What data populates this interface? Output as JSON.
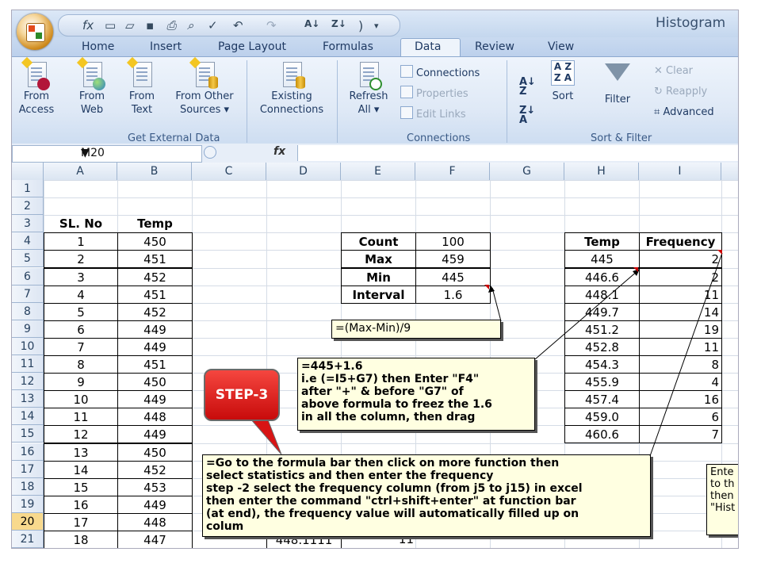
{
  "window": {
    "app_title": "Histogram"
  },
  "tabs": [
    "Home",
    "Insert",
    "Page Layout",
    "Formulas",
    "Data",
    "Review",
    "View"
  ],
  "active_tab": "Data",
  "ribbon": {
    "from_access": [
      "From",
      "Access"
    ],
    "from_web": [
      "From",
      "Web"
    ],
    "from_text": [
      "From",
      "Text"
    ],
    "from_other": [
      "From Other",
      "Sources ▾"
    ],
    "existing": [
      "Existing",
      "Connections"
    ],
    "group_external": "Get External Data",
    "refresh": [
      "Refresh",
      "All ▾"
    ],
    "connections": "Connections",
    "properties": "Properties",
    "edit_links": "Edit Links",
    "group_connections": "Connections",
    "sort": "Sort",
    "filter": "Filter",
    "clear": "Clear",
    "reapply": "Reapply",
    "advanced": "Advanced",
    "group_sort": "Sort & Filter"
  },
  "formula_bar": {
    "name_box": "M20",
    "fx": "fx"
  },
  "columns": [
    "A",
    "B",
    "C",
    "D",
    "E",
    "F",
    "G",
    "H",
    "I"
  ],
  "rows": [
    "1",
    "2",
    "3",
    "4",
    "5",
    "6",
    "7",
    "8",
    "9",
    "10",
    "11",
    "12",
    "13",
    "14",
    "15",
    "16",
    "17",
    "18",
    "19",
    "20",
    "21"
  ],
  "selected_row": "20",
  "headers": {
    "sl_no": "SL. No",
    "temp": "Temp",
    "temp2": "Temp",
    "frequency": "Frequency"
  },
  "sl_no": [
    "1",
    "2",
    "3",
    "4",
    "5",
    "6",
    "7",
    "8",
    "9",
    "10",
    "11",
    "12",
    "13",
    "14",
    "15",
    "16",
    "17",
    "18"
  ],
  "temps": [
    "450",
    "451",
    "452",
    "451",
    "452",
    "449",
    "449",
    "451",
    "450",
    "449",
    "448",
    "449",
    "450",
    "452",
    "453",
    "449",
    "448",
    "447"
  ],
  "stats": [
    {
      "label": "Count",
      "value": "100"
    },
    {
      "label": "Max",
      "value": "459"
    },
    {
      "label": "Min",
      "value": "445"
    },
    {
      "label": "Interval",
      "value": "1.6"
    }
  ],
  "bins": [
    "445",
    "446.6",
    "448.1",
    "449.7",
    "451.2",
    "452.8",
    "454.3",
    "455.9",
    "457.4",
    "459.0",
    "460.6"
  ],
  "frequencies": [
    "2",
    "2",
    "11",
    "14",
    "19",
    "11",
    "8",
    "4",
    "16",
    "6",
    "7"
  ],
  "row21": {
    "d": "448.1111",
    "e": "11"
  },
  "notes": {
    "interval_formula": "=(Max-Min)/9",
    "bin_formula": [
      "=445+1.6",
      " i.e (=I5+G7) then Enter \"F4\"",
      "after \"+\" & before \"G7\" of",
      "above formula to freez the 1.6",
      "in all the column, then drag"
    ],
    "step_label": "STEP-3",
    "frequency_instructions": [
      "=Go to the formula bar then click on more function then",
      "select statistics and then enter the frequency",
      " step -2 select the frequency column (from j5 to j15) in excel",
      "then enter the command \"ctrl+shift+enter\" at function bar",
      "(at end), the frequency value will automatically filled up on",
      "colum"
    ],
    "side_note": [
      "Ente",
      "to th",
      "then",
      "\"Hist"
    ]
  }
}
